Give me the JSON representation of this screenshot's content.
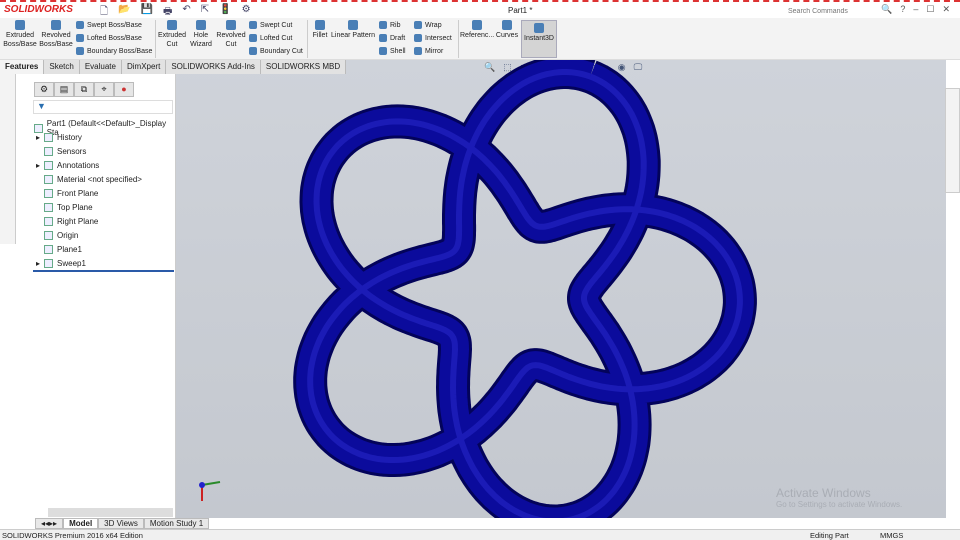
{
  "app": {
    "logo": "SOLIDWORKS",
    "doc_title": "Part1 *",
    "search_placeholder": "Search Commands",
    "help": "?"
  },
  "ribbon": {
    "extruded_boss": "Extruded Boss/Base",
    "revolved_boss": "Revolved Boss/Base",
    "swept_boss": "Swept Boss/Base",
    "lofted_boss": "Lofted Boss/Base",
    "boundary_boss": "Boundary Boss/Base",
    "extruded_cut": "Extruded Cut",
    "hole_wizard": "Hole Wizard",
    "revolved_cut": "Revolved Cut",
    "swept_cut": "Swept Cut",
    "lofted_cut": "Lofted Cut",
    "boundary_cut": "Boundary Cut",
    "fillet": "Fillet",
    "linear_pattern": "Linear Pattern",
    "rib": "Rib",
    "draft": "Draft",
    "shell": "Shell",
    "wrap": "Wrap",
    "intersect": "Intersect",
    "mirror": "Mirror",
    "reference": "Referenc...",
    "curves": "Curves",
    "instant3d": "Instant3D"
  },
  "tabs": [
    "Features",
    "Sketch",
    "Evaluate",
    "DimXpert",
    "SOLIDWORKS Add-Ins",
    "SOLIDWORKS MBD"
  ],
  "tree": {
    "root": "Part1  (Default<<Default>_Display Sta",
    "items": [
      "History",
      "Sensors",
      "Annotations",
      "Material <not specified>",
      "Front Plane",
      "Top Plane",
      "Right Plane",
      "Origin",
      "Plane1",
      "Sweep1"
    ]
  },
  "watermark": {
    "title": "Activate Windows",
    "sub": "Go to Settings to activate Windows."
  },
  "bottom_tabs": [
    "Model",
    "3D Views",
    "Motion Study 1"
  ],
  "status": {
    "edition": "SOLIDWORKS Premium 2016 x64 Edition",
    "mode": "Editing Part",
    "units": "MMGS"
  },
  "colors": {
    "model": "#0b0b9c",
    "accent": "#d22"
  }
}
